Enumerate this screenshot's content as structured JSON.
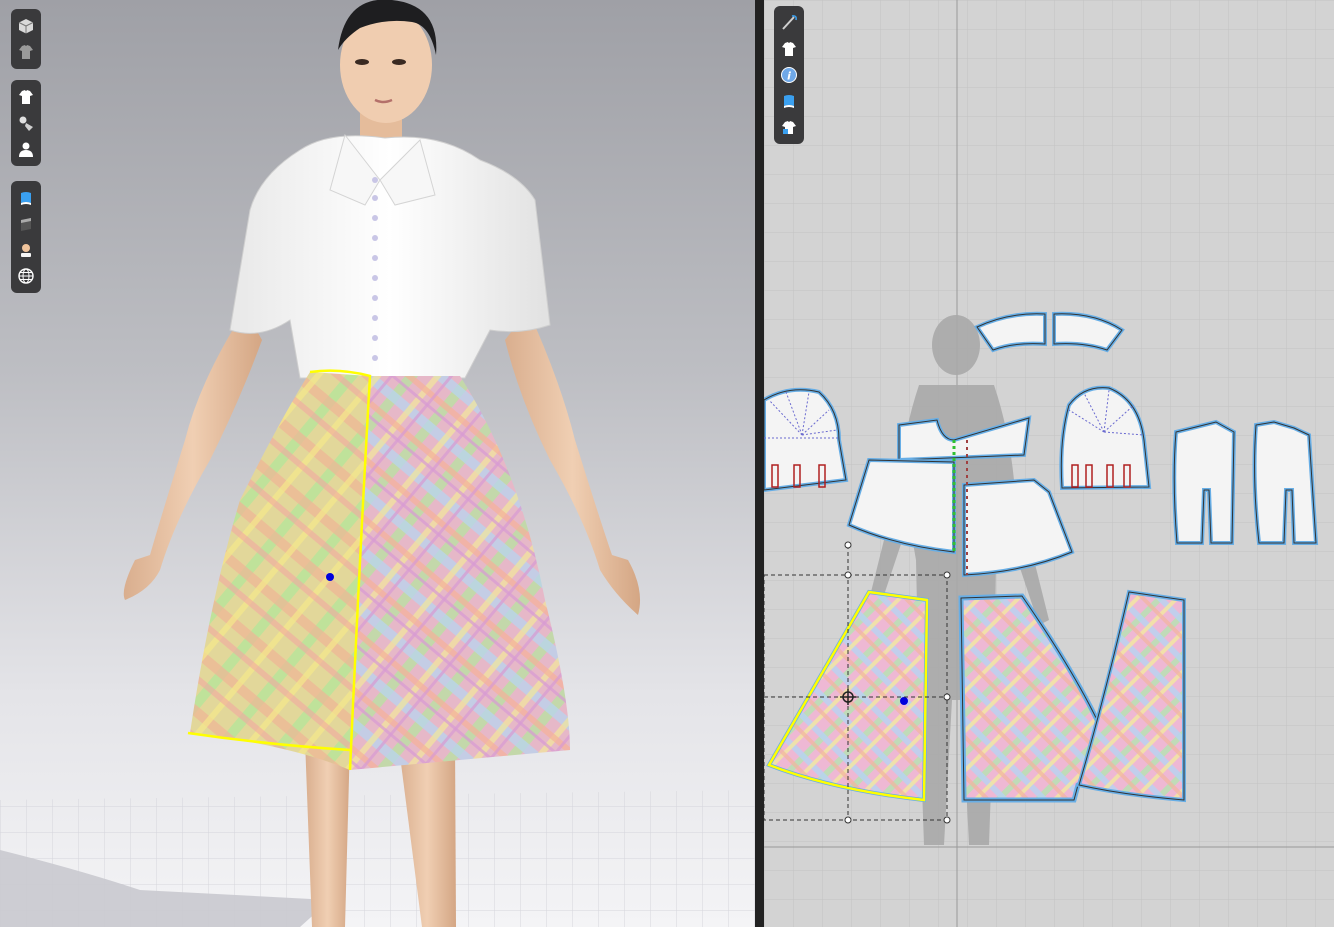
{
  "app": {
    "accent": "#5aa0e0",
    "selection_color": "#ffff00"
  },
  "viewport3d": {
    "toolbar_groups": [
      [
        {
          "icon": "cube-display-icon"
        },
        {
          "icon": "garment-display-icon"
        }
      ],
      [
        {
          "icon": "shirt-icon"
        },
        {
          "icon": "fabric-texture-icon"
        },
        {
          "icon": "avatar-icon"
        }
      ],
      [
        {
          "icon": "blue-fabric-icon"
        },
        {
          "icon": "gray-fabric-icon"
        },
        {
          "icon": "skin-icon"
        },
        {
          "icon": "globe-icon"
        }
      ]
    ]
  },
  "view2d": {
    "toolbar": [
      {
        "icon": "needle-icon"
      },
      {
        "icon": "shirt-white-icon"
      },
      {
        "icon": "info-icon",
        "glyph": "i"
      },
      {
        "icon": "blue-fabric-2d-icon"
      },
      {
        "icon": "house-shirt-icon"
      }
    ],
    "pattern_pieces": [
      {
        "name": "collar-left"
      },
      {
        "name": "collar-right"
      },
      {
        "name": "sleeve-left"
      },
      {
        "name": "bodice-front-yoke"
      },
      {
        "name": "bodice-front-lower-left"
      },
      {
        "name": "bodice-front-lower-right"
      },
      {
        "name": "sleeve-right"
      },
      {
        "name": "back-panel-left"
      },
      {
        "name": "back-panel-right"
      },
      {
        "name": "skirt-front-left"
      },
      {
        "name": "skirt-front-right"
      },
      {
        "name": "skirt-back"
      }
    ]
  }
}
